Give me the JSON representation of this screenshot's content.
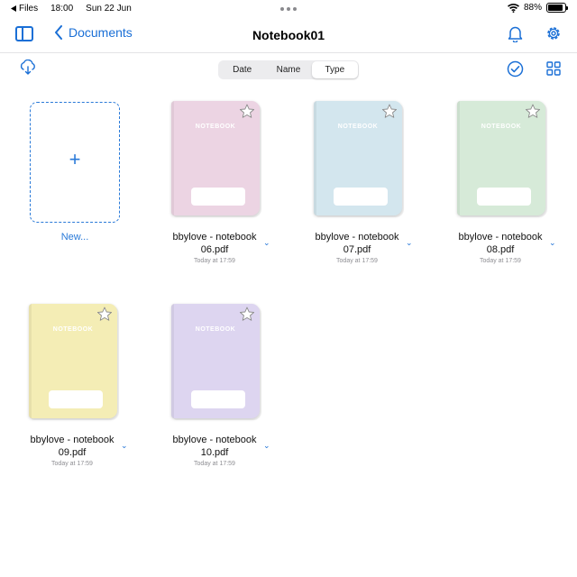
{
  "status": {
    "back_app": "Files",
    "time": "18:00",
    "date": "Sun 22 Jun",
    "battery": "88%",
    "battery_level": 0.88
  },
  "nav": {
    "back_label": "Documents",
    "title": "Notebook01"
  },
  "sort": {
    "options": [
      "Date",
      "Name",
      "Type"
    ],
    "selected": "Type"
  },
  "new_item": {
    "label": "New..."
  },
  "files": [
    {
      "name_line1": "bbylove - notebook",
      "name_line2": "06.pdf",
      "date": "Today at 17:59",
      "color": "#ecd4e3",
      "cover_title": "NOTEBOOK"
    },
    {
      "name_line1": "bbylove - notebook",
      "name_line2": "07.pdf",
      "date": "Today at 17:59",
      "color": "#d3e6ee",
      "cover_title": "NOTEBOOK"
    },
    {
      "name_line1": "bbylove - notebook",
      "name_line2": "08.pdf",
      "date": "Today at 17:59",
      "color": "#d6ead8",
      "cover_title": "NOTEBOOK"
    },
    {
      "name_line1": "bbylove - notebook",
      "name_line2": "09.pdf",
      "date": "Today at 17:59",
      "color": "#f4edb5",
      "cover_title": "NOTEBOOK"
    },
    {
      "name_line1": "bbylove - notebook",
      "name_line2": "10.pdf",
      "date": "Today at 17:59",
      "color": "#ddd5f0",
      "cover_title": "NOTEBOOK"
    }
  ],
  "colors": {
    "accent": "#1a6fd6"
  }
}
